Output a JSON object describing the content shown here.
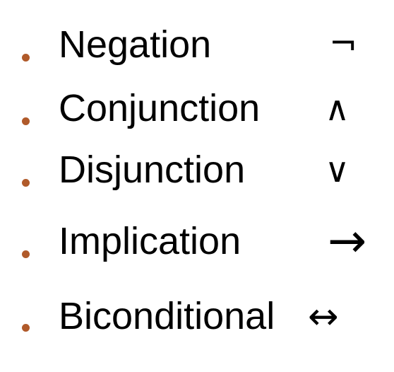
{
  "colors": {
    "bullet": "#b05a2a",
    "text": "#000000",
    "background": "#ffffff"
  },
  "items": [
    {
      "label": "Negation",
      "symbol": "¬"
    },
    {
      "label": "Conjunction",
      "symbol": "∧"
    },
    {
      "label": "Disjunction",
      "symbol": "∨"
    },
    {
      "label": "Implication",
      "symbol": "→"
    },
    {
      "label": "Biconditional",
      "symbol": "↔"
    }
  ]
}
